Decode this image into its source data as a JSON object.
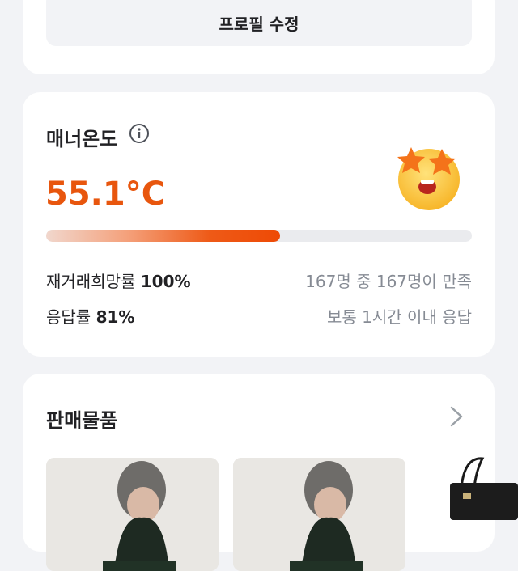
{
  "profile": {
    "edit_button": "프로필 수정"
  },
  "manner": {
    "title": "매너온도",
    "temperature": "55.1°C",
    "progress_fraction": 0.55,
    "rehire_label": "재거래희망률",
    "rehire_value": "100%",
    "rehire_detail": "167명 중 167명이 만족",
    "response_label": "응답률",
    "response_value": "81%",
    "response_detail": "보통 1시간 이내 응답"
  },
  "sales": {
    "title": "판매물품"
  },
  "colors": {
    "accent": "#e8560e",
    "background": "#f2f3f6",
    "muted_text": "#868b94"
  },
  "icons": [
    "info-icon",
    "star-eyes-face-icon",
    "chevron-right-icon"
  ]
}
